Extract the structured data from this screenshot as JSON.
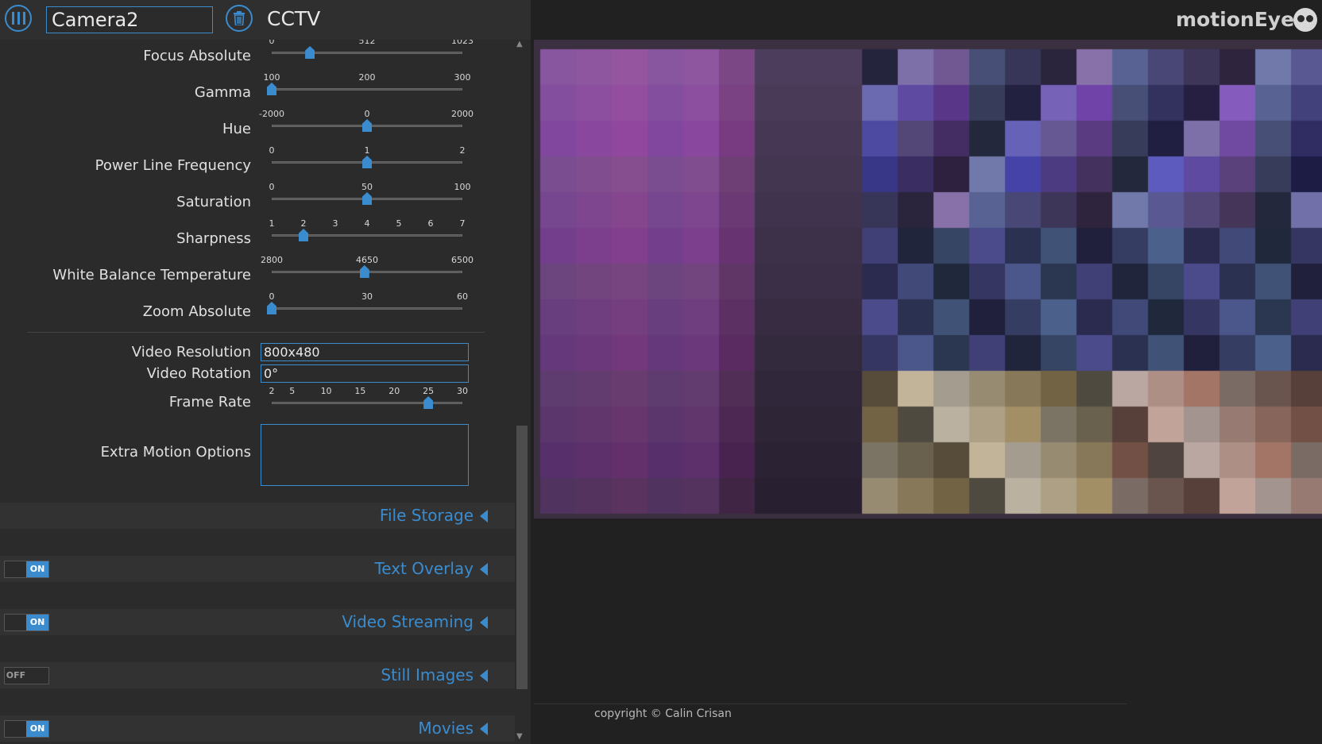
{
  "header": {
    "camera_name": "Camera2",
    "camera_group": "CCTV",
    "brand": "motionEye"
  },
  "sliders": [
    {
      "key": "focus_absolute",
      "label": "Focus Absolute",
      "ticks": [
        "0",
        "512",
        "1023"
      ],
      "min": 0,
      "max": 1023,
      "value": 205
    },
    {
      "key": "gamma",
      "label": "Gamma",
      "ticks": [
        "100",
        "200",
        "300"
      ],
      "min": 100,
      "max": 300,
      "value": 100
    },
    {
      "key": "hue",
      "label": "Hue",
      "ticks": [
        "-2000",
        "0",
        "2000"
      ],
      "min": -2000,
      "max": 2000,
      "value": 0
    },
    {
      "key": "power_line",
      "label": "Power Line Frequency",
      "ticks": [
        "0",
        "1",
        "2"
      ],
      "min": 0,
      "max": 2,
      "value": 1
    },
    {
      "key": "saturation",
      "label": "Saturation",
      "ticks": [
        "0",
        "50",
        "100"
      ],
      "min": 0,
      "max": 100,
      "value": 50
    },
    {
      "key": "sharpness",
      "label": "Sharpness",
      "ticks": [
        "1",
        "2",
        "3",
        "4",
        "5",
        "6",
        "7"
      ],
      "min": 1,
      "max": 7,
      "value": 2
    },
    {
      "key": "wb_temp",
      "label": "White Balance Temperature",
      "ticks": [
        "2800",
        "4650",
        "6500"
      ],
      "min": 2800,
      "max": 6500,
      "value": 4600
    },
    {
      "key": "zoom",
      "label": "Zoom Absolute",
      "ticks": [
        "0",
        "30",
        "60"
      ],
      "min": 0,
      "max": 60,
      "value": 0
    }
  ],
  "video": {
    "resolution_label": "Video Resolution",
    "resolution_value": "800x480",
    "rotation_label": "Video Rotation",
    "rotation_value": "0°",
    "framerate_label": "Frame Rate",
    "framerate_ticks": [
      "2",
      "5",
      "10",
      "15",
      "20",
      "25",
      "30"
    ],
    "framerate_value": 25,
    "extra_label": "Extra Motion Options"
  },
  "sections": [
    {
      "title": "File Storage",
      "toggle": null
    },
    {
      "title": "Text Overlay",
      "toggle": "ON"
    },
    {
      "title": "Video Streaming",
      "toggle": "ON"
    },
    {
      "title": "Still Images",
      "toggle": "OFF"
    },
    {
      "title": "Movies",
      "toggle": "ON"
    }
  ],
  "footer": {
    "copyright": "copyright © Calin Crisan"
  },
  "colors": {
    "accent": "#3a8ccf",
    "panel": "#2b2b2b",
    "background": "#212121"
  }
}
